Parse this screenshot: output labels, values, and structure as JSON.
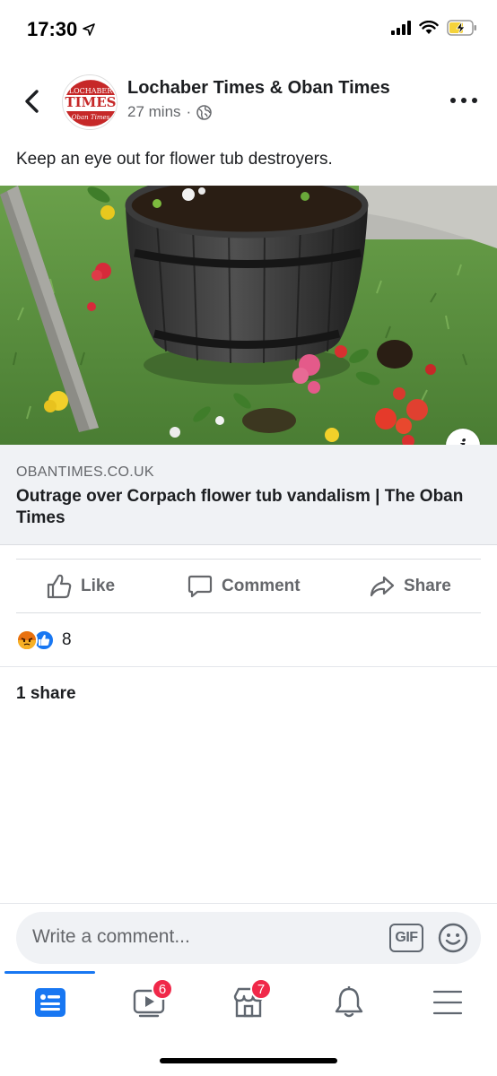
{
  "status_bar": {
    "time": "17:30",
    "location_icon": "location-arrow-icon",
    "signal_icon": "cellular-signal-icon",
    "wifi_icon": "wifi-icon",
    "battery_icon": "battery-charging-icon"
  },
  "post": {
    "page_name": "Lochaber Times & Oban Times",
    "time_ago": "27 mins",
    "separator": "·",
    "privacy_icon": "globe-icon",
    "text": "Keep an eye out for flower tub destroyers.",
    "avatar": {
      "line1": "LOCHABER",
      "line2": "TIMES",
      "line3": "Oban Times"
    }
  },
  "link_preview": {
    "domain": "OBANTIMES.CO.UK",
    "title": "Outrage over Corpach flower tub vandalism | The Oban Times",
    "info_label": "i"
  },
  "actions": {
    "like": "Like",
    "comment": "Comment",
    "share": "Share"
  },
  "reactions": {
    "types": [
      "angry",
      "like"
    ],
    "count": "8"
  },
  "shares": "1 share",
  "composer": {
    "placeholder": "Write a comment...",
    "gif_label": "GIF"
  },
  "tab_bar": {
    "tabs": [
      {
        "name": "news-feed",
        "icon": "news-feed-icon",
        "badge": "",
        "active": true
      },
      {
        "name": "watch",
        "icon": "watch-video-icon",
        "badge": "6",
        "active": false
      },
      {
        "name": "marketplace",
        "icon": "marketplace-icon",
        "badge": "7",
        "active": false
      },
      {
        "name": "notifications",
        "icon": "bell-icon",
        "badge": "",
        "active": false
      },
      {
        "name": "menu",
        "icon": "hamburger-menu-icon",
        "badge": "",
        "active": false
      }
    ]
  },
  "colors": {
    "accent": "#1877f2",
    "badge": "#f02849",
    "secondary_text": "#65676b",
    "link_box_bg": "#f0f2f5"
  }
}
